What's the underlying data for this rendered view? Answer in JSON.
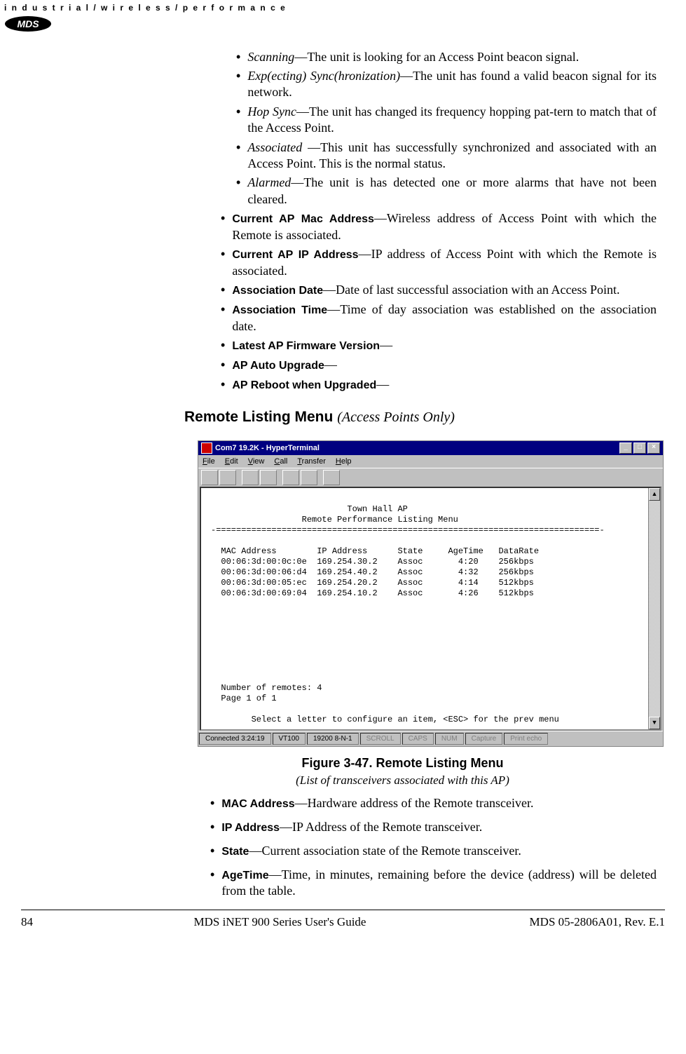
{
  "header": {
    "tagline": "i n d u s t r i a l / w i r e l e s s / p e r f o r m a n c e",
    "logo_text": "MDS"
  },
  "status_terms": {
    "items": [
      {
        "term": "Scanning",
        "desc": "—The unit is looking for an Access Point beacon signal."
      },
      {
        "term": "Exp(ecting) Sync(hronization)",
        "desc": "—The unit has found a valid beacon signal for its network."
      },
      {
        "term": "Hop Sync",
        "desc": "—The unit has changed its frequency hopping pat-tern to match that of the Access Point."
      },
      {
        "term": "Associated ",
        "desc": "—This unit has successfully synchronized and associated with an Access Point. This is the normal status."
      },
      {
        "term": "Alarmed",
        "desc": "—The unit is has detected one or more alarms that have not been cleared."
      }
    ]
  },
  "config_terms": {
    "items": [
      {
        "term": "Current AP Mac Address",
        "desc": "—Wireless address of Access Point with which the Remote is associated."
      },
      {
        "term": "Current AP IP Address",
        "desc": "—IP address of Access Point with which the Remote is associated."
      },
      {
        "term": "Association Date",
        "desc": "—Date of last successful association with an Access Point."
      },
      {
        "term": "Association Time",
        "desc": "—Time of day association was established on the association date."
      },
      {
        "term": "Latest AP Firmware Version",
        "desc": "—"
      },
      {
        "term": "AP Auto Upgrade",
        "desc": "—"
      },
      {
        "term": "AP Reboot when Upgraded",
        "desc": "—"
      }
    ]
  },
  "section_heading": {
    "bold": "Remote Listing Menu ",
    "italic": "(Access Points Only)"
  },
  "terminal": {
    "title": "Com7 19.2K - HyperTerminal",
    "menu": [
      "File",
      "Edit",
      "View",
      "Call",
      "Transfer",
      "Help"
    ],
    "header_line1": "Town Hall AP",
    "header_line2": "Remote Performance Listing Menu",
    "divider": "-============================================================================-",
    "col_header": "MAC Address        IP Address      State     AgeTime   DataRate",
    "rows": [
      "00:06:3d:00:0c:0e  169.254.30.2    Assoc       4:20    256kbps",
      "00:06:3d:00:06:d4  169.254.40.2    Assoc       4:32    256kbps",
      "00:06:3d:00:05:ec  169.254.20.2    Assoc       4:14    512kbps",
      "00:06:3d:00:69:04  169.254.10.2    Assoc       4:26    512kbps"
    ],
    "remotes_line": "Number of remotes: 4",
    "page_line": "Page 1 of 1",
    "prompt_line": "Select a letter to configure an item, <ESC> for the prev menu",
    "status": {
      "connected": "Connected 3:24:19",
      "emulation": "VT100",
      "baud": "19200 8-N-1",
      "scroll": "SCROLL",
      "caps": "CAPS",
      "num": "NUM",
      "capture": "Capture",
      "print": "Print echo"
    }
  },
  "chart_data": {
    "type": "table",
    "title": "Remote Performance Listing Menu — Town Hall AP",
    "columns": [
      "MAC Address",
      "IP Address",
      "State",
      "AgeTime",
      "DataRate"
    ],
    "rows": [
      [
        "00:06:3d:00:0c:0e",
        "169.254.30.2",
        "Assoc",
        "4:20",
        "256kbps"
      ],
      [
        "00:06:3d:00:06:d4",
        "169.254.40.2",
        "Assoc",
        "4:32",
        "256kbps"
      ],
      [
        "00:06:3d:00:05:ec",
        "169.254.20.2",
        "Assoc",
        "4:14",
        "512kbps"
      ],
      [
        "00:06:3d:00:69:04",
        "169.254.10.2",
        "Assoc",
        "4:26",
        "512kbps"
      ]
    ],
    "number_of_remotes": 4,
    "page": "1 of 1"
  },
  "figure_caption": {
    "bold": "Figure 3-47. Remote Listing Menu",
    "italic": "(List of transceivers associated with this AP)"
  },
  "lower_terms": {
    "items": [
      {
        "term": "MAC Address",
        "desc": "—Hardware address of the Remote transceiver."
      },
      {
        "term": "IP Address",
        "desc": "—IP Address of the Remote transceiver."
      },
      {
        "term": "State",
        "desc": "—Current association state of the Remote transceiver."
      },
      {
        "term": "AgeTime",
        "desc": "—Time, in minutes, remaining before the device (address) will be deleted from the table."
      }
    ]
  },
  "footer": {
    "page_num": "84",
    "center": "MDS iNET 900 Series User's Guide",
    "right": "MDS 05-2806A01, Rev. E.1"
  }
}
